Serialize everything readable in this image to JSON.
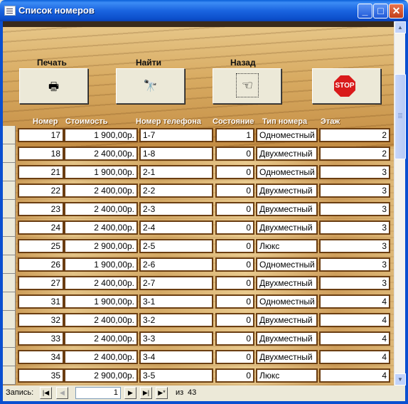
{
  "window": {
    "title": "Список номеров",
    "minimize": "_",
    "maximize": "□",
    "close": "✕"
  },
  "toolbar": {
    "print_label": "Печать",
    "find_label": "Найти",
    "back_label": "Назад",
    "stop_label": "STOP",
    "print_icon": "🖶",
    "find_icon": "🔭",
    "back_icon": "☜"
  },
  "columns": [
    "Номер",
    "Стоимость",
    "Номер телефона",
    "Состояние",
    "Тип номера",
    "Этаж"
  ],
  "rows": [
    {
      "number": "17",
      "price": "1 900,00р.",
      "phone": "1-7",
      "state": "1",
      "type": "Одноместный",
      "floor": "2"
    },
    {
      "number": "18",
      "price": "2 400,00р.",
      "phone": "1-8",
      "state": "0",
      "type": "Двухместный",
      "floor": "2"
    },
    {
      "number": "21",
      "price": "1 900,00р.",
      "phone": "2-1",
      "state": "0",
      "type": "Одноместный",
      "floor": "3"
    },
    {
      "number": "22",
      "price": "2 400,00р.",
      "phone": "2-2",
      "state": "0",
      "type": "Двухместный",
      "floor": "3"
    },
    {
      "number": "23",
      "price": "2 400,00р.",
      "phone": "2-3",
      "state": "0",
      "type": "Двухместный",
      "floor": "3"
    },
    {
      "number": "24",
      "price": "2 400,00р.",
      "phone": "2-4",
      "state": "0",
      "type": "Двухместный",
      "floor": "3"
    },
    {
      "number": "25",
      "price": "2 900,00р.",
      "phone": "2-5",
      "state": "0",
      "type": "Люкс",
      "floor": "3"
    },
    {
      "number": "26",
      "price": "1 900,00р.",
      "phone": "2-6",
      "state": "0",
      "type": "Одноместный",
      "floor": "3"
    },
    {
      "number": "27",
      "price": "2 400,00р.",
      "phone": "2-7",
      "state": "0",
      "type": "Двухместный",
      "floor": "3"
    },
    {
      "number": "31",
      "price": "1 900,00р.",
      "phone": "3-1",
      "state": "0",
      "type": "Одноместный",
      "floor": "4"
    },
    {
      "number": "32",
      "price": "2 400,00р.",
      "phone": "3-2",
      "state": "0",
      "type": "Двухместный",
      "floor": "4"
    },
    {
      "number": "33",
      "price": "2 400,00р.",
      "phone": "3-3",
      "state": "0",
      "type": "Двухместный",
      "floor": "4"
    },
    {
      "number": "34",
      "price": "2 400,00р.",
      "phone": "3-4",
      "state": "0",
      "type": "Двухместный",
      "floor": "4"
    },
    {
      "number": "35",
      "price": "2 900,00р.",
      "phone": "3-5",
      "state": "0",
      "type": "Люкс",
      "floor": "4"
    }
  ],
  "navigation": {
    "record_label": "Запись:",
    "current": "1",
    "of_label": "из",
    "total": "43",
    "first_icon": "|◀",
    "prev_icon": "◀",
    "next_icon": "▶",
    "last_icon": "▶|",
    "new_icon": "▶*"
  },
  "colors": {
    "titlebar": "#0A5FD8",
    "cell_border": "#6b3e12",
    "stop_red": "#d91a1a"
  }
}
